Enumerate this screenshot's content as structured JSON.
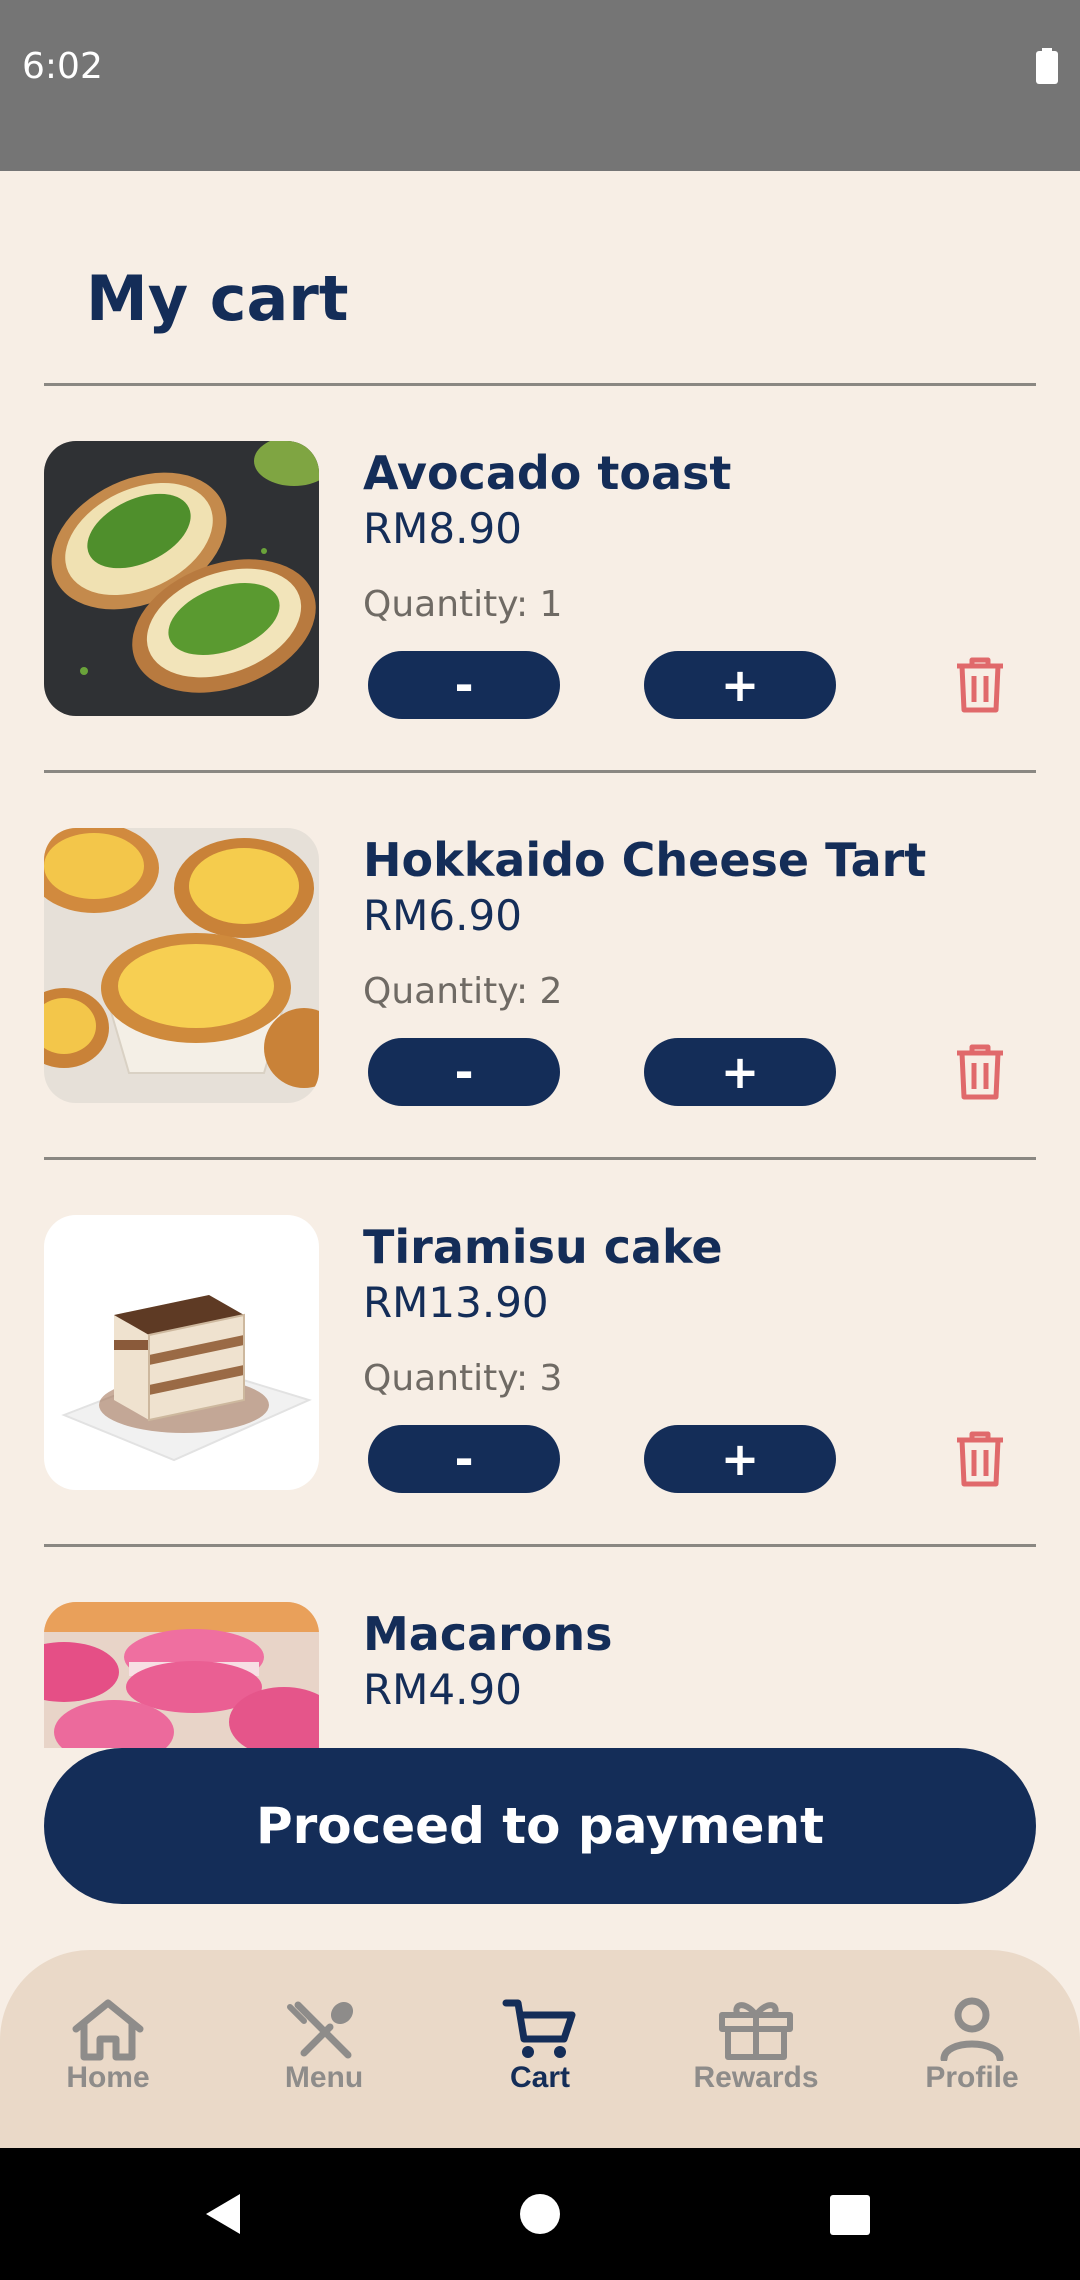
{
  "status_bar": {
    "time": "6:02",
    "battery_icon": "battery-icon"
  },
  "page": {
    "title": "My cart"
  },
  "cart_items": [
    {
      "name": "Avocado toast",
      "price": "RM8.90",
      "quantity_label": "Quantity: 1",
      "minus_label": "-",
      "plus_label": "+",
      "image": "avocado-toast-photo"
    },
    {
      "name": "Hokkaido Cheese Tart",
      "price": "RM6.90",
      "quantity_label": "Quantity: 2",
      "minus_label": "-",
      "plus_label": "+",
      "image": "cheese-tart-photo"
    },
    {
      "name": "Tiramisu cake",
      "price": "RM13.90",
      "quantity_label": "Quantity: 3",
      "minus_label": "-",
      "plus_label": "+",
      "image": "tiramisu-photo"
    },
    {
      "name": "Macarons",
      "price": "RM4.90",
      "image": "macarons-photo"
    }
  ],
  "actions": {
    "proceed_label": "Proceed to payment"
  },
  "bottom_nav": {
    "items": [
      {
        "label": "Home",
        "icon": "home-icon",
        "active": false
      },
      {
        "label": "Menu",
        "icon": "utensils-icon",
        "active": false
      },
      {
        "label": "Cart",
        "icon": "cart-icon",
        "active": true
      },
      {
        "label": "Rewards",
        "icon": "gift-icon",
        "active": false
      },
      {
        "label": "Profile",
        "icon": "profile-icon",
        "active": false
      }
    ]
  },
  "colors": {
    "background": "#f7eee5",
    "primary": "#142d58",
    "delete": "#e0696b",
    "nav_background": "#ead9c8",
    "nav_inactive": "#8e8c8a",
    "status_bar": "#757575"
  }
}
